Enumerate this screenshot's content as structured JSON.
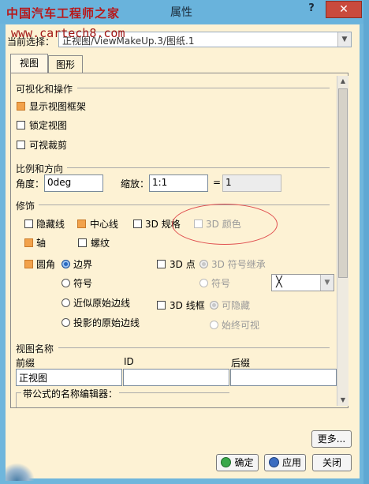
{
  "window": {
    "title": "属性",
    "help": "?",
    "close": "✕",
    "watermark": "中国汽车工程师之家",
    "watermark_url": "www.cartech8.com"
  },
  "current_selection": {
    "label": "当前选择：",
    "value": "正视图/ViewMakeUp.3/图纸.1"
  },
  "tabs": [
    {
      "label": "视图",
      "selected": true
    },
    {
      "label": "图形",
      "selected": false
    }
  ],
  "visualization": {
    "header": "可视化和操作",
    "options": [
      {
        "label": "显示视图框架",
        "checked": true
      },
      {
        "label": "锁定视图",
        "checked": false
      },
      {
        "label": "可视裁剪",
        "checked": false
      }
    ]
  },
  "scale": {
    "header": "比例和方向",
    "angle_label": "角度：",
    "angle_value": "0deg",
    "zoom_label": "缩放：",
    "zoom_value": "1:1",
    "equals": "=",
    "computed_value": "1"
  },
  "dress_up": {
    "header": "修饰",
    "hidden_lines": {
      "label": "隐藏线",
      "checked": false
    },
    "center_line": {
      "label": "中心线",
      "checked": true
    },
    "spec_3d": {
      "label": "3D 规格",
      "checked": false
    },
    "color_3d": {
      "label": "3D 颜色",
      "checked": false,
      "disabled": true
    },
    "axis": {
      "label": "轴",
      "checked": true
    },
    "thread": {
      "label": "螺纹",
      "checked": false
    },
    "fillet": {
      "label": "圆角",
      "checked": true
    },
    "fillet_options": [
      {
        "label": "边界",
        "on": true
      },
      {
        "label": "符号",
        "on": false
      },
      {
        "label": "近似原始边线",
        "on": false
      },
      {
        "label": "投影的原始边线",
        "on": false
      }
    ],
    "point_3d": {
      "label": "3D 点",
      "checked": false
    },
    "point_options": [
      {
        "label": "3D 符号继承",
        "on": true
      },
      {
        "label": "符号",
        "on": false
      }
    ],
    "symbol_select": "╳",
    "wireframe_3d": {
      "label": "3D 线框",
      "checked": false
    },
    "wireframe_options": [
      {
        "label": "可隐藏",
        "on": true
      },
      {
        "label": "始终可视",
        "on": false
      }
    ]
  },
  "view_name": {
    "header": "视图名称",
    "prefix_label": "前缀",
    "id_label": "ID",
    "suffix_label": "后缀",
    "prefix_value": "正视图",
    "id_value": "",
    "suffix_value": "",
    "formula_editor": "带公式的名称编辑器："
  },
  "buttons": {
    "more": "更多...",
    "ok": "确定",
    "apply": "应用",
    "close": "关闭"
  }
}
